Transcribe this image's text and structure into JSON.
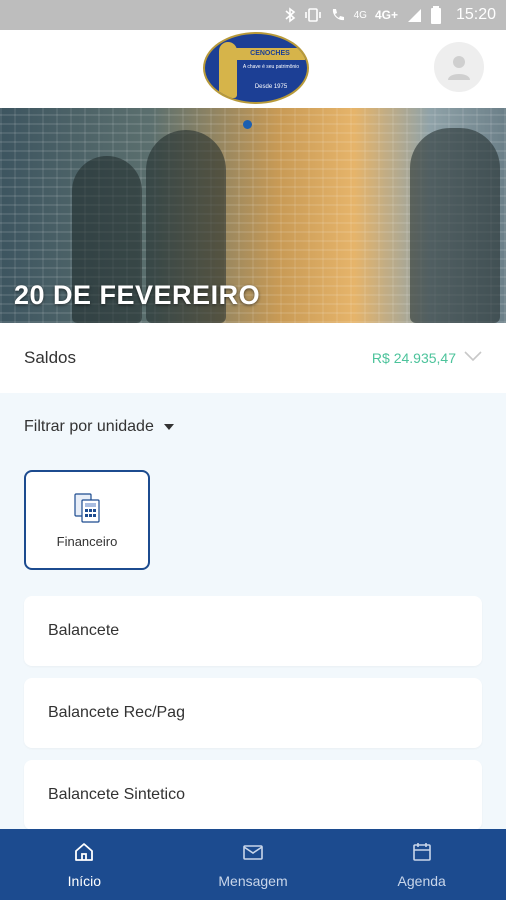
{
  "status_bar": {
    "network": "4G",
    "network_sup": "4G+",
    "time": "15:20"
  },
  "header": {
    "logo": {
      "brand": "CENOCHES IMOVEIS",
      "tagline": "A chave é seu patrimônio",
      "since": "Desde 1975"
    }
  },
  "banner": {
    "date": "20 DE FEVEREIRO"
  },
  "saldos": {
    "label": "Saldos",
    "value": "R$ 24.935,47"
  },
  "filter": {
    "label": "Filtrar por unidade"
  },
  "categories": [
    {
      "label": "Financeiro",
      "icon": "financial-report-icon"
    }
  ],
  "reports": [
    {
      "label": "Balancete"
    },
    {
      "label": "Balancete Rec/Pag"
    },
    {
      "label": "Balancete Sintetico"
    }
  ],
  "bottom_nav": [
    {
      "label": "Início",
      "icon": "home-icon",
      "active": true
    },
    {
      "label": "Mensagem",
      "icon": "mail-icon",
      "active": false
    },
    {
      "label": "Agenda",
      "icon": "calendar-icon",
      "active": false
    }
  ],
  "colors": {
    "primary": "#1c4b8f",
    "balance": "#4cc39b",
    "background": "#f2f8fc"
  }
}
